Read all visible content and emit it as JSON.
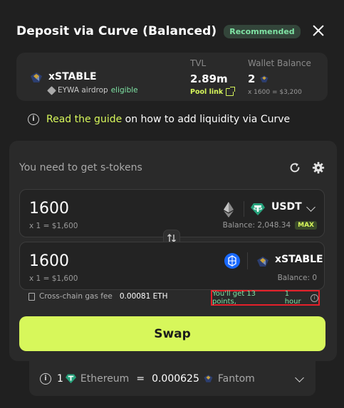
{
  "header": {
    "title": "Deposit via Curve (Balanced)",
    "badge": "Recommended"
  },
  "pool": {
    "token_name": "xSTABLE",
    "airdrop_text": "EYWA airdrop",
    "airdrop_status": "eligible",
    "tvl_label": "TVL",
    "tvl_value": "2.89m",
    "pool_link": "Pool link",
    "wallet_label": "Wallet Balance",
    "wallet_value": "2",
    "wallet_sub": "x 1600 = $3,200"
  },
  "guide": {
    "link": "Read the guide",
    "text": "on how to add liquidity via Curve"
  },
  "swap": {
    "need_text": "You need to get s-tokens",
    "from": {
      "amount": "1600",
      "rate": "x 1 = $1,600",
      "symbol": "USDT",
      "balance": "Balance: 2,048.34",
      "max": "MAX"
    },
    "to": {
      "amount": "1600",
      "rate": "x 1 = $1,600",
      "symbol": "xSTABLE",
      "balance": "Balance: 0"
    },
    "fee_label": "Cross-chain gas fee",
    "fee_value": "0.00081 ETH",
    "points_text": "You'll get 13 points,",
    "points_time": "1 hour",
    "button": "Swap"
  },
  "rate_bar": {
    "left_amount": "1",
    "left_chain": "Ethereum",
    "equals": "=",
    "right_amount": "0.000625",
    "right_chain": "Fantom"
  },
  "colors": {
    "accent": "#d7f75b",
    "green": "#7fe3a4",
    "highlight_border": "#e5202a",
    "tether": "#26a17b",
    "fantom": "#1969ff"
  }
}
